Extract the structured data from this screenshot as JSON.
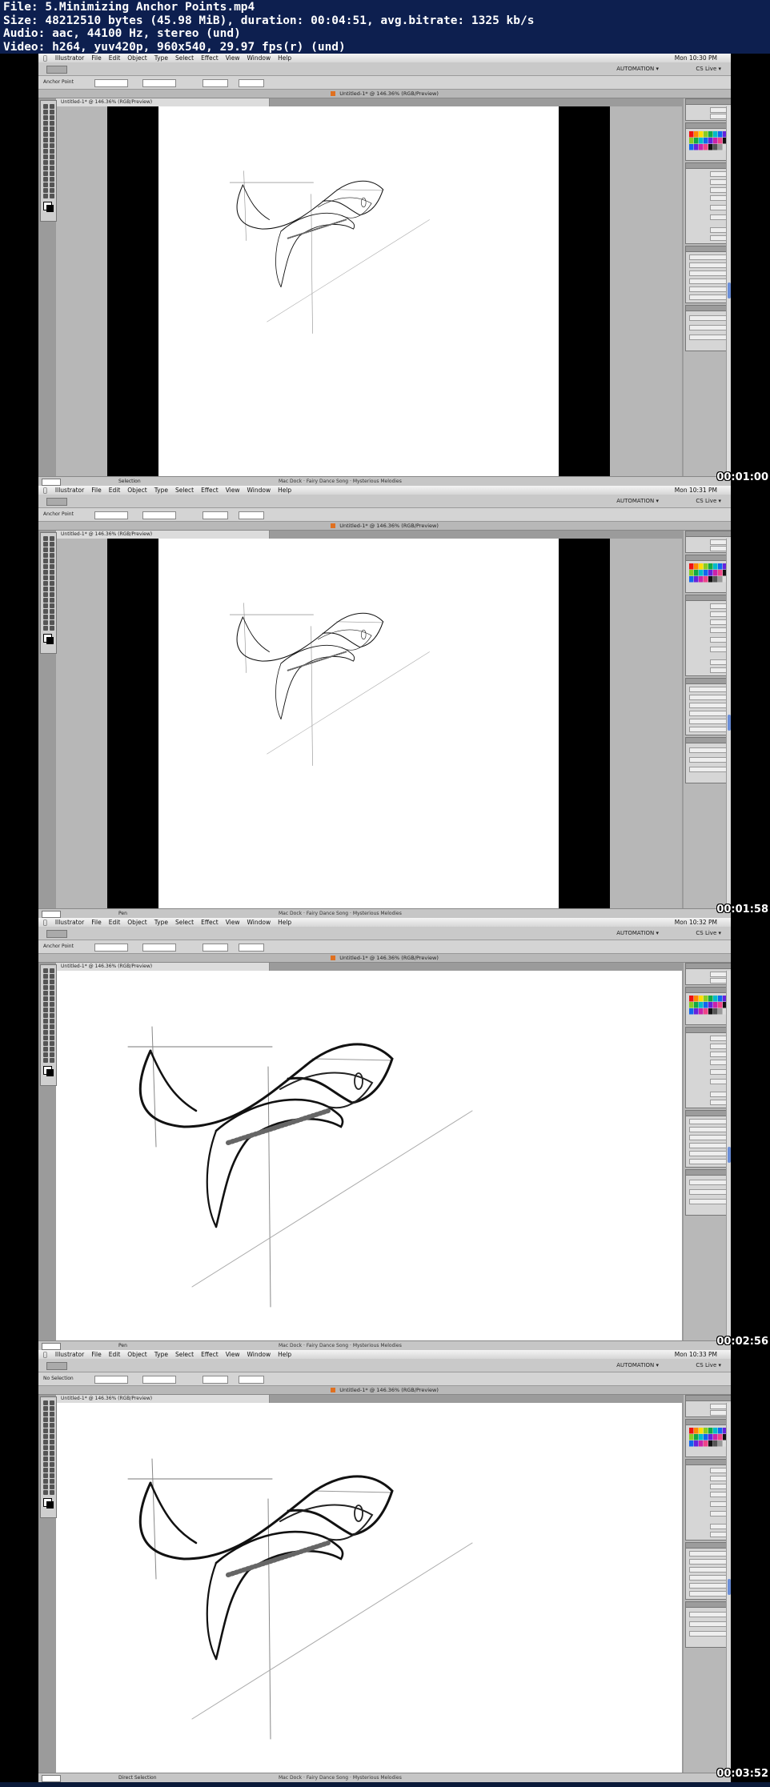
{
  "info": {
    "file": "File: 5.Minimizing Anchor Points.mp4",
    "size": "Size: 48212510 bytes (45.98 MiB), duration: 00:04:51, avg.bitrate: 1325 kb/s",
    "audio": "Audio: aac, 44100 Hz, stereo (und)",
    "video": "Video: h264, yuv420p, 960x540, 29.97 fps(r) (und)"
  },
  "menu": {
    "apple": "",
    "items": [
      "Illustrator",
      "File",
      "Edit",
      "Object",
      "Type",
      "Select",
      "Effect",
      "View",
      "Window",
      "Help"
    ]
  },
  "app": {
    "workspace": "AUTOMATION ▾",
    "cs_live": "CS Live ▾",
    "document_title": "Untitled-1* @ 146.36% (RGB/Preview)"
  },
  "frames": [
    {
      "timestamp": "00:01:00",
      "clock": "Mon 10:30 PM",
      "control_label": "Anchor Point",
      "status_selection": "Selection",
      "status_dock": "Mac Dock · Fairy Dance Song · Mysterious Melodies"
    },
    {
      "timestamp": "00:01:58",
      "clock": "Mon 10:31 PM",
      "control_label": "Anchor Point",
      "status_selection": "Pen",
      "status_dock": "Mac Dock · Fairy Dance Song · Mysterious Melodies"
    },
    {
      "timestamp": "00:02:56",
      "clock": "Mon 10:32 PM",
      "control_label": "Anchor Point",
      "status_selection": "Pen",
      "status_dock": "Mac Dock · Fairy Dance Song · Mysterious Melodies"
    },
    {
      "timestamp": "00:03:52",
      "clock": "Mon 10:33 PM",
      "control_label": "No Selection",
      "status_selection": "Direct Selection",
      "status_dock": "Mac Dock · Fairy Dance Song · Mysterious Melodies"
    }
  ],
  "colors": {
    "info_bg": "#0d1f4f",
    "canvas_gray": "#b7b7b7",
    "artboard": "#ffffff",
    "doc_icon": "#e07020"
  }
}
